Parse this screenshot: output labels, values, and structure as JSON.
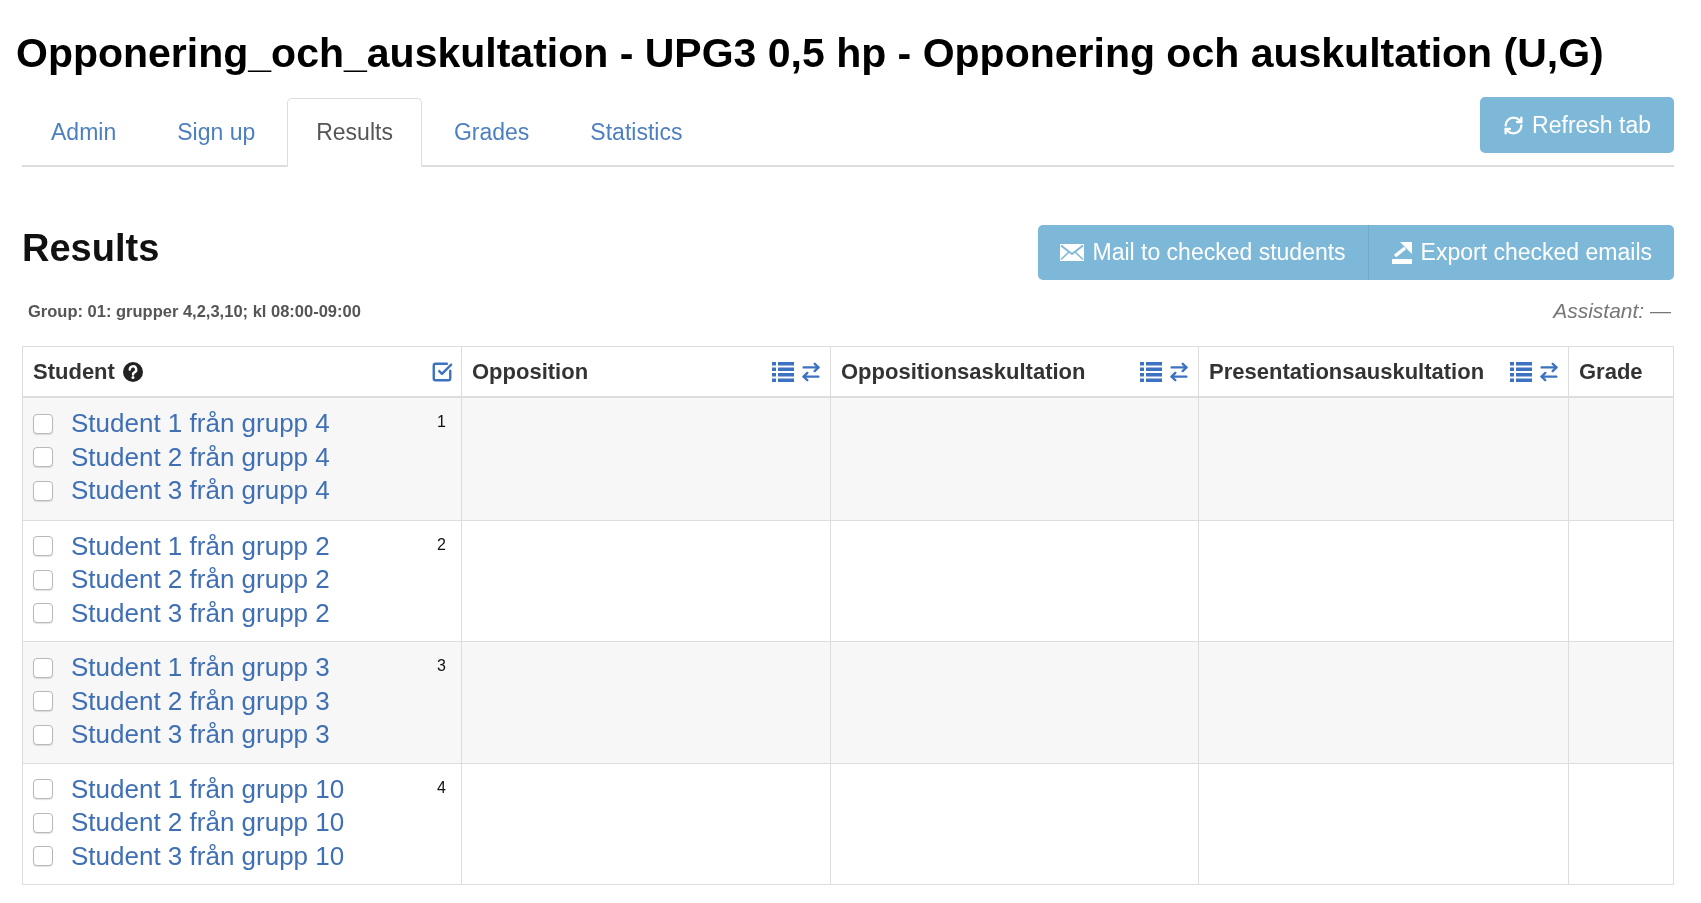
{
  "page_title": "Opponering_och_auskultation - UPG3 0,5 hp - Opponering och auskultation (U,G)",
  "tabs": [
    {
      "label": "Admin",
      "selected": false
    },
    {
      "label": "Sign up",
      "selected": false
    },
    {
      "label": "Results",
      "selected": true
    },
    {
      "label": "Grades",
      "selected": false
    },
    {
      "label": "Statistics",
      "selected": false
    }
  ],
  "refresh_button": {
    "label": "Refresh tab"
  },
  "results": {
    "heading": "Results",
    "actions": [
      {
        "kind": "mail",
        "label": "Mail to checked students"
      },
      {
        "kind": "export",
        "label": "Export checked emails"
      }
    ],
    "group_info": "Group: 01: grupper 4,2,3,10; kl 08:00-09:00",
    "assistant": "Assistant: —",
    "table": {
      "columns": [
        {
          "kind": "student",
          "label": "Student"
        },
        {
          "kind": "assessment",
          "label": "Opposition"
        },
        {
          "kind": "assessment",
          "label": "Oppositionsaskultation"
        },
        {
          "kind": "assessment",
          "label": "Presentationsauskultation"
        },
        {
          "kind": "plain",
          "label": "Grade"
        }
      ],
      "rows": [
        {
          "number": "1",
          "students": [
            {
              "name": "Student 1 från grupp 4",
              "checked": false
            },
            {
              "name": "Student 2 från grupp 4",
              "checked": false
            },
            {
              "name": "Student 3 från grupp 4",
              "checked": false
            }
          ]
        },
        {
          "number": "2",
          "students": [
            {
              "name": "Student 1 från grupp 2",
              "checked": false
            },
            {
              "name": "Student 2 från grupp 2",
              "checked": false
            },
            {
              "name": "Student 3 från grupp 2",
              "checked": false
            }
          ]
        },
        {
          "number": "3",
          "students": [
            {
              "name": "Student 1 från grupp 3",
              "checked": false
            },
            {
              "name": "Student 2 från grupp 3",
              "checked": false
            },
            {
              "name": "Student 3 från grupp 3",
              "checked": false
            }
          ]
        },
        {
          "number": "4",
          "students": [
            {
              "name": "Student 1 från grupp 10",
              "checked": false
            },
            {
              "name": "Student 2 från grupp 10",
              "checked": false
            },
            {
              "name": "Student 3 från grupp 10",
              "checked": false
            }
          ]
        }
      ]
    }
  }
}
